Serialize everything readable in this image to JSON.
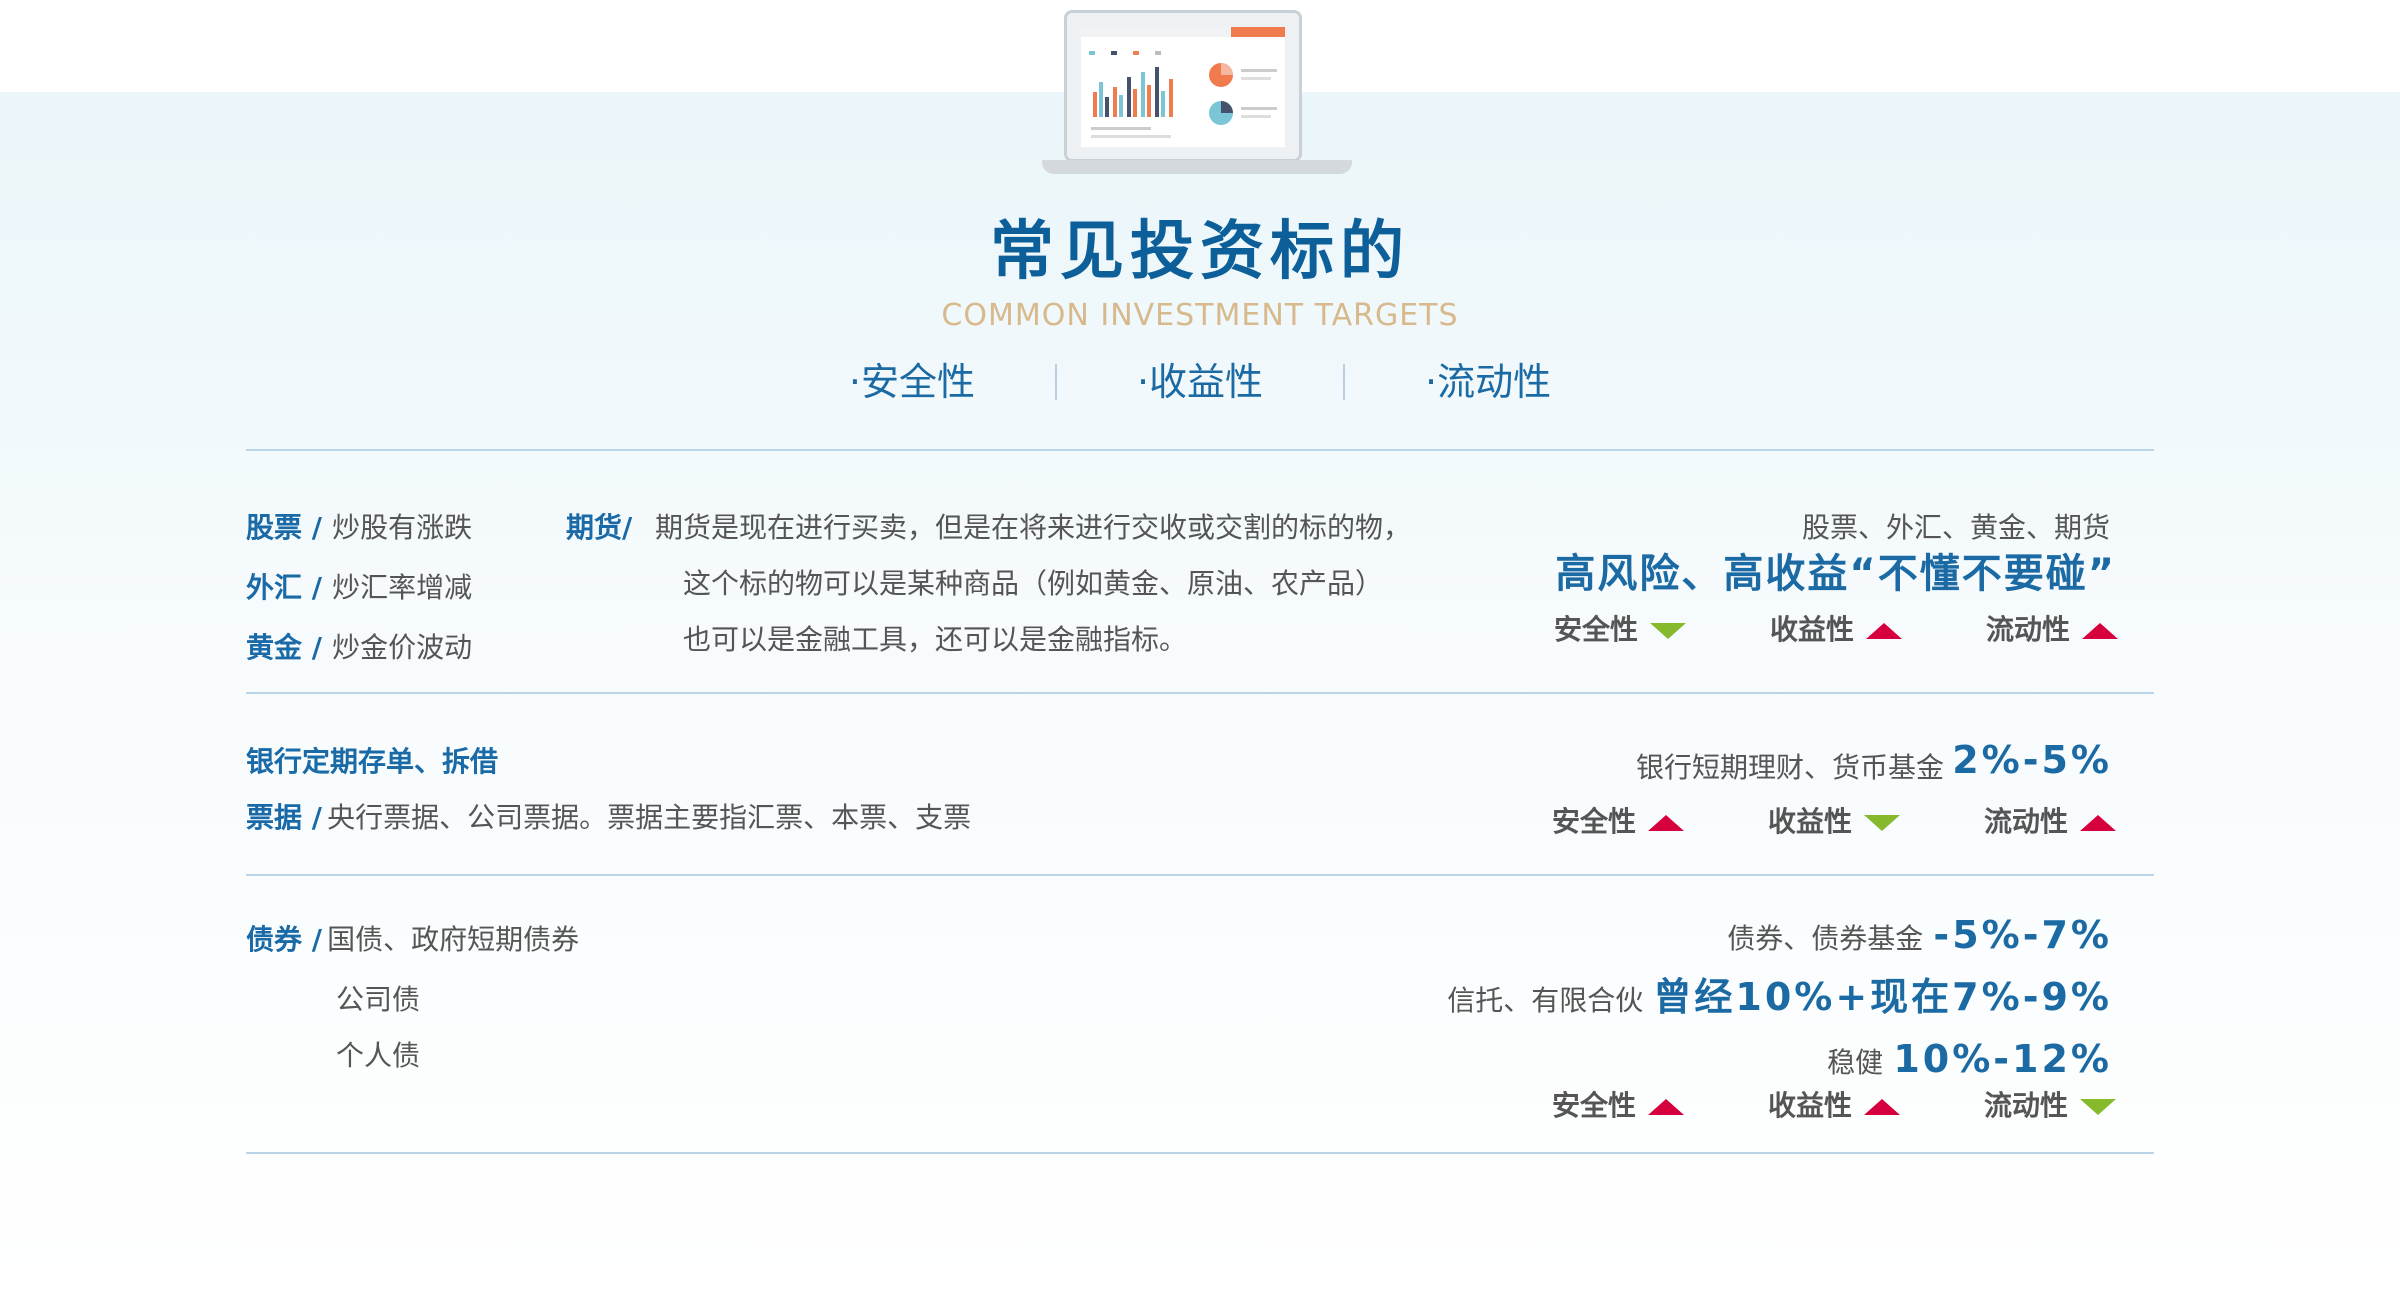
{
  "header": {
    "title": "常见投资标的",
    "subtitle": "COMMON INVESTMENT TARGETS",
    "tabs": [
      "·安全性",
      "·收益性",
      "·流动性"
    ]
  },
  "indicator_labels": [
    "安全性",
    "收益性",
    "流动性"
  ],
  "section1": {
    "left": [
      {
        "label": "股票 /",
        "text": "炒股有涨跌"
      },
      {
        "label": "外汇 /",
        "text": "炒汇率增减"
      },
      {
        "label": "黄金 /",
        "text": "炒金价波动"
      }
    ],
    "futures_label": "期货/",
    "futures_lines": [
      "期货是现在进行买卖，但是在将来进行交收或交割的标的物，",
      "这个标的物可以是某种商品（例如黄金、原油、农产品）",
      "也可以是金融工具，还可以是金融指标。"
    ],
    "right_caption": "股票、外汇、黄金、期货",
    "right_headline": "高风险、高收益“不懂不要碰”",
    "indicators": [
      "down",
      "up",
      "up"
    ]
  },
  "section2": {
    "line1": "银行定期存单、拆借",
    "line2_label": "票据 /",
    "line2_text": "央行票据、公司票据。票据主要指汇票、本票、支票",
    "right_caption": "银行短期理财、货币基金",
    "right_pct": "2%-5%",
    "indicators": [
      "up",
      "down",
      "up"
    ]
  },
  "section3": {
    "label": "债券 /",
    "items": [
      "国债、政府短期债券",
      "公司债",
      "个人债"
    ],
    "right_rows": [
      {
        "caption": "债券、债券基金",
        "value": "-5%-7%"
      },
      {
        "caption": "信托、有限合伙",
        "value": "曾经10%+现在7%-9%"
      },
      {
        "caption": "稳健",
        "value": "10%-12%"
      }
    ],
    "indicators": [
      "up",
      "up",
      "down"
    ]
  },
  "colors": {
    "accent": "#1b6aa3",
    "up": "#d5003d",
    "down": "#86b92c",
    "subtitle": "#d8b98c"
  }
}
